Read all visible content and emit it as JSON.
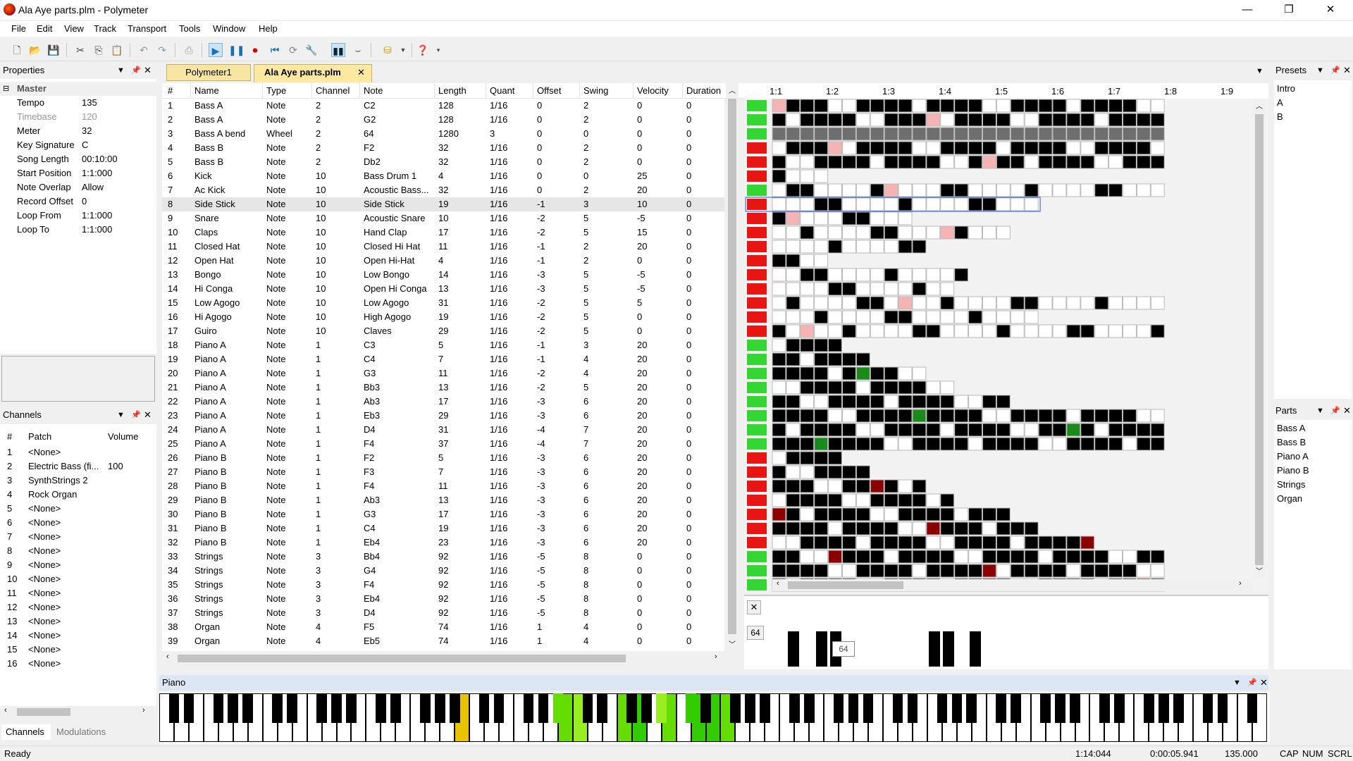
{
  "window": {
    "title": "Ala Aye parts.plm - Polymeter",
    "minimize": "—",
    "restore": "❐",
    "close": "✕"
  },
  "menu": [
    "File",
    "Edit",
    "View",
    "Track",
    "Transport",
    "Tools",
    "Window",
    "Help"
  ],
  "properties": {
    "title": "Properties",
    "group": "Master",
    "rows": [
      {
        "name": "Tempo",
        "value": "135",
        "disabled": false
      },
      {
        "name": "Timebase",
        "value": "120",
        "disabled": true
      },
      {
        "name": "Meter",
        "value": "32",
        "disabled": false
      },
      {
        "name": "Key Signature",
        "value": "C",
        "disabled": false
      },
      {
        "name": "Song Length",
        "value": "00:10:00",
        "disabled": false
      },
      {
        "name": "Start Position",
        "value": "1:1:000",
        "disabled": false
      },
      {
        "name": "Note Overlap",
        "value": "Allow",
        "disabled": false
      },
      {
        "name": "Record Offset",
        "value": "0",
        "disabled": false
      },
      {
        "name": "Loop From",
        "value": "1:1:000",
        "disabled": false
      },
      {
        "name": "Loop To",
        "value": "1:1:000",
        "disabled": false
      }
    ]
  },
  "channels": {
    "title": "Channels",
    "headers": [
      "#",
      "Patch",
      "Volume"
    ],
    "rows": [
      {
        "n": "1",
        "patch": "<None>",
        "vol": ""
      },
      {
        "n": "2",
        "patch": "Electric Bass (fi...",
        "vol": "100"
      },
      {
        "n": "3",
        "patch": "SynthStrings 2",
        "vol": ""
      },
      {
        "n": "4",
        "patch": "Rock Organ",
        "vol": ""
      },
      {
        "n": "5",
        "patch": "<None>",
        "vol": ""
      },
      {
        "n": "6",
        "patch": "<None>",
        "vol": ""
      },
      {
        "n": "7",
        "patch": "<None>",
        "vol": ""
      },
      {
        "n": "8",
        "patch": "<None>",
        "vol": ""
      },
      {
        "n": "9",
        "patch": "<None>",
        "vol": ""
      },
      {
        "n": "10",
        "patch": "<None>",
        "vol": ""
      },
      {
        "n": "11",
        "patch": "<None>",
        "vol": ""
      },
      {
        "n": "12",
        "patch": "<None>",
        "vol": ""
      },
      {
        "n": "13",
        "patch": "<None>",
        "vol": ""
      },
      {
        "n": "14",
        "patch": "<None>",
        "vol": ""
      },
      {
        "n": "15",
        "patch": "<None>",
        "vol": ""
      },
      {
        "n": "16",
        "patch": "<None>",
        "vol": ""
      }
    ],
    "tabs": [
      "Channels",
      "Modulations"
    ]
  },
  "doc_tabs": [
    {
      "label": "Polymeter1",
      "active": false
    },
    {
      "label": "Ala Aye parts.plm",
      "active": true
    }
  ],
  "tracks": {
    "headers": [
      "#",
      "Name",
      "Type",
      "Channel",
      "Note",
      "Length",
      "Quant",
      "Offset",
      "Swing",
      "Velocity",
      "Duration"
    ],
    "rows": [
      [
        "1",
        "Bass A",
        "Note",
        "2",
        "C2",
        "128",
        "1/16",
        "0",
        "2",
        "0",
        "0"
      ],
      [
        "2",
        "Bass A",
        "Note",
        "2",
        "G2",
        "128",
        "1/16",
        "0",
        "2",
        "0",
        "0"
      ],
      [
        "3",
        "Bass A bend",
        "Wheel",
        "2",
        "64",
        "1280",
        "3",
        "0",
        "0",
        "0",
        "0"
      ],
      [
        "4",
        "Bass B",
        "Note",
        "2",
        "F2",
        "32",
        "1/16",
        "0",
        "2",
        "0",
        "0"
      ],
      [
        "5",
        "Bass B",
        "Note",
        "2",
        "Db2",
        "32",
        "1/16",
        "0",
        "2",
        "0",
        "0"
      ],
      [
        "6",
        "Kick",
        "Note",
        "10",
        "Bass Drum 1",
        "4",
        "1/16",
        "0",
        "0",
        "25",
        "0"
      ],
      [
        "7",
        "Ac Kick",
        "Note",
        "10",
        "Acoustic Bass...",
        "32",
        "1/16",
        "0",
        "2",
        "20",
        "0"
      ],
      [
        "8",
        "Side Stick",
        "Note",
        "10",
        "Side Stick",
        "19",
        "1/16",
        "-1",
        "3",
        "10",
        "0"
      ],
      [
        "9",
        "Snare",
        "Note",
        "10",
        "Acoustic Snare",
        "10",
        "1/16",
        "-2",
        "5",
        "-5",
        "0"
      ],
      [
        "10",
        "Claps",
        "Note",
        "10",
        "Hand Clap",
        "17",
        "1/16",
        "-2",
        "5",
        "15",
        "0"
      ],
      [
        "11",
        "Closed Hat",
        "Note",
        "10",
        "Closed Hi Hat",
        "11",
        "1/16",
        "-1",
        "2",
        "20",
        "0"
      ],
      [
        "12",
        "Open Hat",
        "Note",
        "10",
        "Open Hi-Hat",
        "4",
        "1/16",
        "-1",
        "2",
        "0",
        "0"
      ],
      [
        "13",
        "Bongo",
        "Note",
        "10",
        "Low Bongo",
        "14",
        "1/16",
        "-3",
        "5",
        "-5",
        "0"
      ],
      [
        "14",
        "Hi Conga",
        "Note",
        "10",
        "Open Hi Conga",
        "13",
        "1/16",
        "-3",
        "5",
        "-5",
        "0"
      ],
      [
        "15",
        "Low Agogo",
        "Note",
        "10",
        "Low Agogo",
        "31",
        "1/16",
        "-2",
        "5",
        "5",
        "0"
      ],
      [
        "16",
        "Hi Agogo",
        "Note",
        "10",
        "High Agogo",
        "19",
        "1/16",
        "-2",
        "5",
        "0",
        "0"
      ],
      [
        "17",
        "Guiro",
        "Note",
        "10",
        "Claves",
        "29",
        "1/16",
        "-2",
        "5",
        "0",
        "0"
      ],
      [
        "18",
        "Piano A",
        "Note",
        "1",
        "C3",
        "5",
        "1/16",
        "-1",
        "3",
        "20",
        "0"
      ],
      [
        "19",
        "Piano A",
        "Note",
        "1",
        "C4",
        "7",
        "1/16",
        "-1",
        "4",
        "20",
        "0"
      ],
      [
        "20",
        "Piano A",
        "Note",
        "1",
        "G3",
        "11",
        "1/16",
        "-2",
        "4",
        "20",
        "0"
      ],
      [
        "21",
        "Piano A",
        "Note",
        "1",
        "Bb3",
        "13",
        "1/16",
        "-2",
        "5",
        "20",
        "0"
      ],
      [
        "22",
        "Piano A",
        "Note",
        "1",
        "Ab3",
        "17",
        "1/16",
        "-3",
        "6",
        "20",
        "0"
      ],
      [
        "23",
        "Piano A",
        "Note",
        "1",
        "Eb3",
        "29",
        "1/16",
        "-3",
        "6",
        "20",
        "0"
      ],
      [
        "24",
        "Piano A",
        "Note",
        "1",
        "D4",
        "31",
        "1/16",
        "-4",
        "7",
        "20",
        "0"
      ],
      [
        "25",
        "Piano A",
        "Note",
        "1",
        "F4",
        "37",
        "1/16",
        "-4",
        "7",
        "20",
        "0"
      ],
      [
        "26",
        "Piano B",
        "Note",
        "1",
        "F2",
        "5",
        "1/16",
        "-3",
        "6",
        "20",
        "0"
      ],
      [
        "27",
        "Piano B",
        "Note",
        "1",
        "F3",
        "7",
        "1/16",
        "-3",
        "6",
        "20",
        "0"
      ],
      [
        "28",
        "Piano B",
        "Note",
        "1",
        "F4",
        "11",
        "1/16",
        "-3",
        "6",
        "20",
        "0"
      ],
      [
        "29",
        "Piano B",
        "Note",
        "1",
        "Ab3",
        "13",
        "1/16",
        "-3",
        "6",
        "20",
        "0"
      ],
      [
        "30",
        "Piano B",
        "Note",
        "1",
        "G3",
        "17",
        "1/16",
        "-3",
        "6",
        "20",
        "0"
      ],
      [
        "31",
        "Piano B",
        "Note",
        "1",
        "C4",
        "19",
        "1/16",
        "-3",
        "6",
        "20",
        "0"
      ],
      [
        "32",
        "Piano B",
        "Note",
        "1",
        "Eb4",
        "23",
        "1/16",
        "-3",
        "6",
        "20",
        "0"
      ],
      [
        "33",
        "Strings",
        "Note",
        "3",
        "Bb4",
        "92",
        "1/16",
        "-5",
        "8",
        "0",
        "0"
      ],
      [
        "34",
        "Strings",
        "Note",
        "3",
        "G4",
        "92",
        "1/16",
        "-5",
        "8",
        "0",
        "0"
      ],
      [
        "35",
        "Strings",
        "Note",
        "3",
        "F4",
        "92",
        "1/16",
        "-5",
        "8",
        "0",
        "0"
      ],
      [
        "36",
        "Strings",
        "Note",
        "3",
        "Eb4",
        "92",
        "1/16",
        "-5",
        "8",
        "0",
        "0"
      ],
      [
        "37",
        "Strings",
        "Note",
        "3",
        "D4",
        "92",
        "1/16",
        "-5",
        "8",
        "0",
        "0"
      ],
      [
        "38",
        "Organ",
        "Note",
        "4",
        "F5",
        "74",
        "1/16",
        "1",
        "4",
        "0",
        "0"
      ],
      [
        "39",
        "Organ",
        "Note",
        "4",
        "Eb5",
        "74",
        "1/16",
        "1",
        "4",
        "0",
        "0"
      ]
    ]
  },
  "ruler": [
    "1:1",
    "1:2",
    "1:3",
    "1:4",
    "1:5",
    "1:6",
    "1:7",
    "1:8",
    "1:9"
  ],
  "mutes": [
    "green",
    "green",
    "green",
    "red",
    "red",
    "red",
    "green",
    "red",
    "red",
    "red",
    "red",
    "red",
    "red",
    "red",
    "red",
    "red",
    "red",
    "green",
    "green",
    "green",
    "green",
    "green",
    "green",
    "green",
    "green",
    "red",
    "red",
    "red",
    "red",
    "red",
    "red",
    "red",
    "green",
    "green",
    "green"
  ],
  "velocity": {
    "label": "64",
    "tooltip": "64"
  },
  "presets": {
    "title": "Presets",
    "items": [
      "Intro",
      "A",
      "B"
    ]
  },
  "parts": {
    "title": "Parts",
    "items": [
      "Bass A",
      "Bass B",
      "Piano A",
      "Piano B",
      "Strings",
      "Organ"
    ]
  },
  "piano": {
    "title": "Piano"
  },
  "status": {
    "ready": "Ready",
    "position": "1:14:044",
    "time": "0:00:05.941",
    "tempo": "135.000",
    "cap": "CAP",
    "num": "NUM",
    "scrl": "SCRL"
  }
}
